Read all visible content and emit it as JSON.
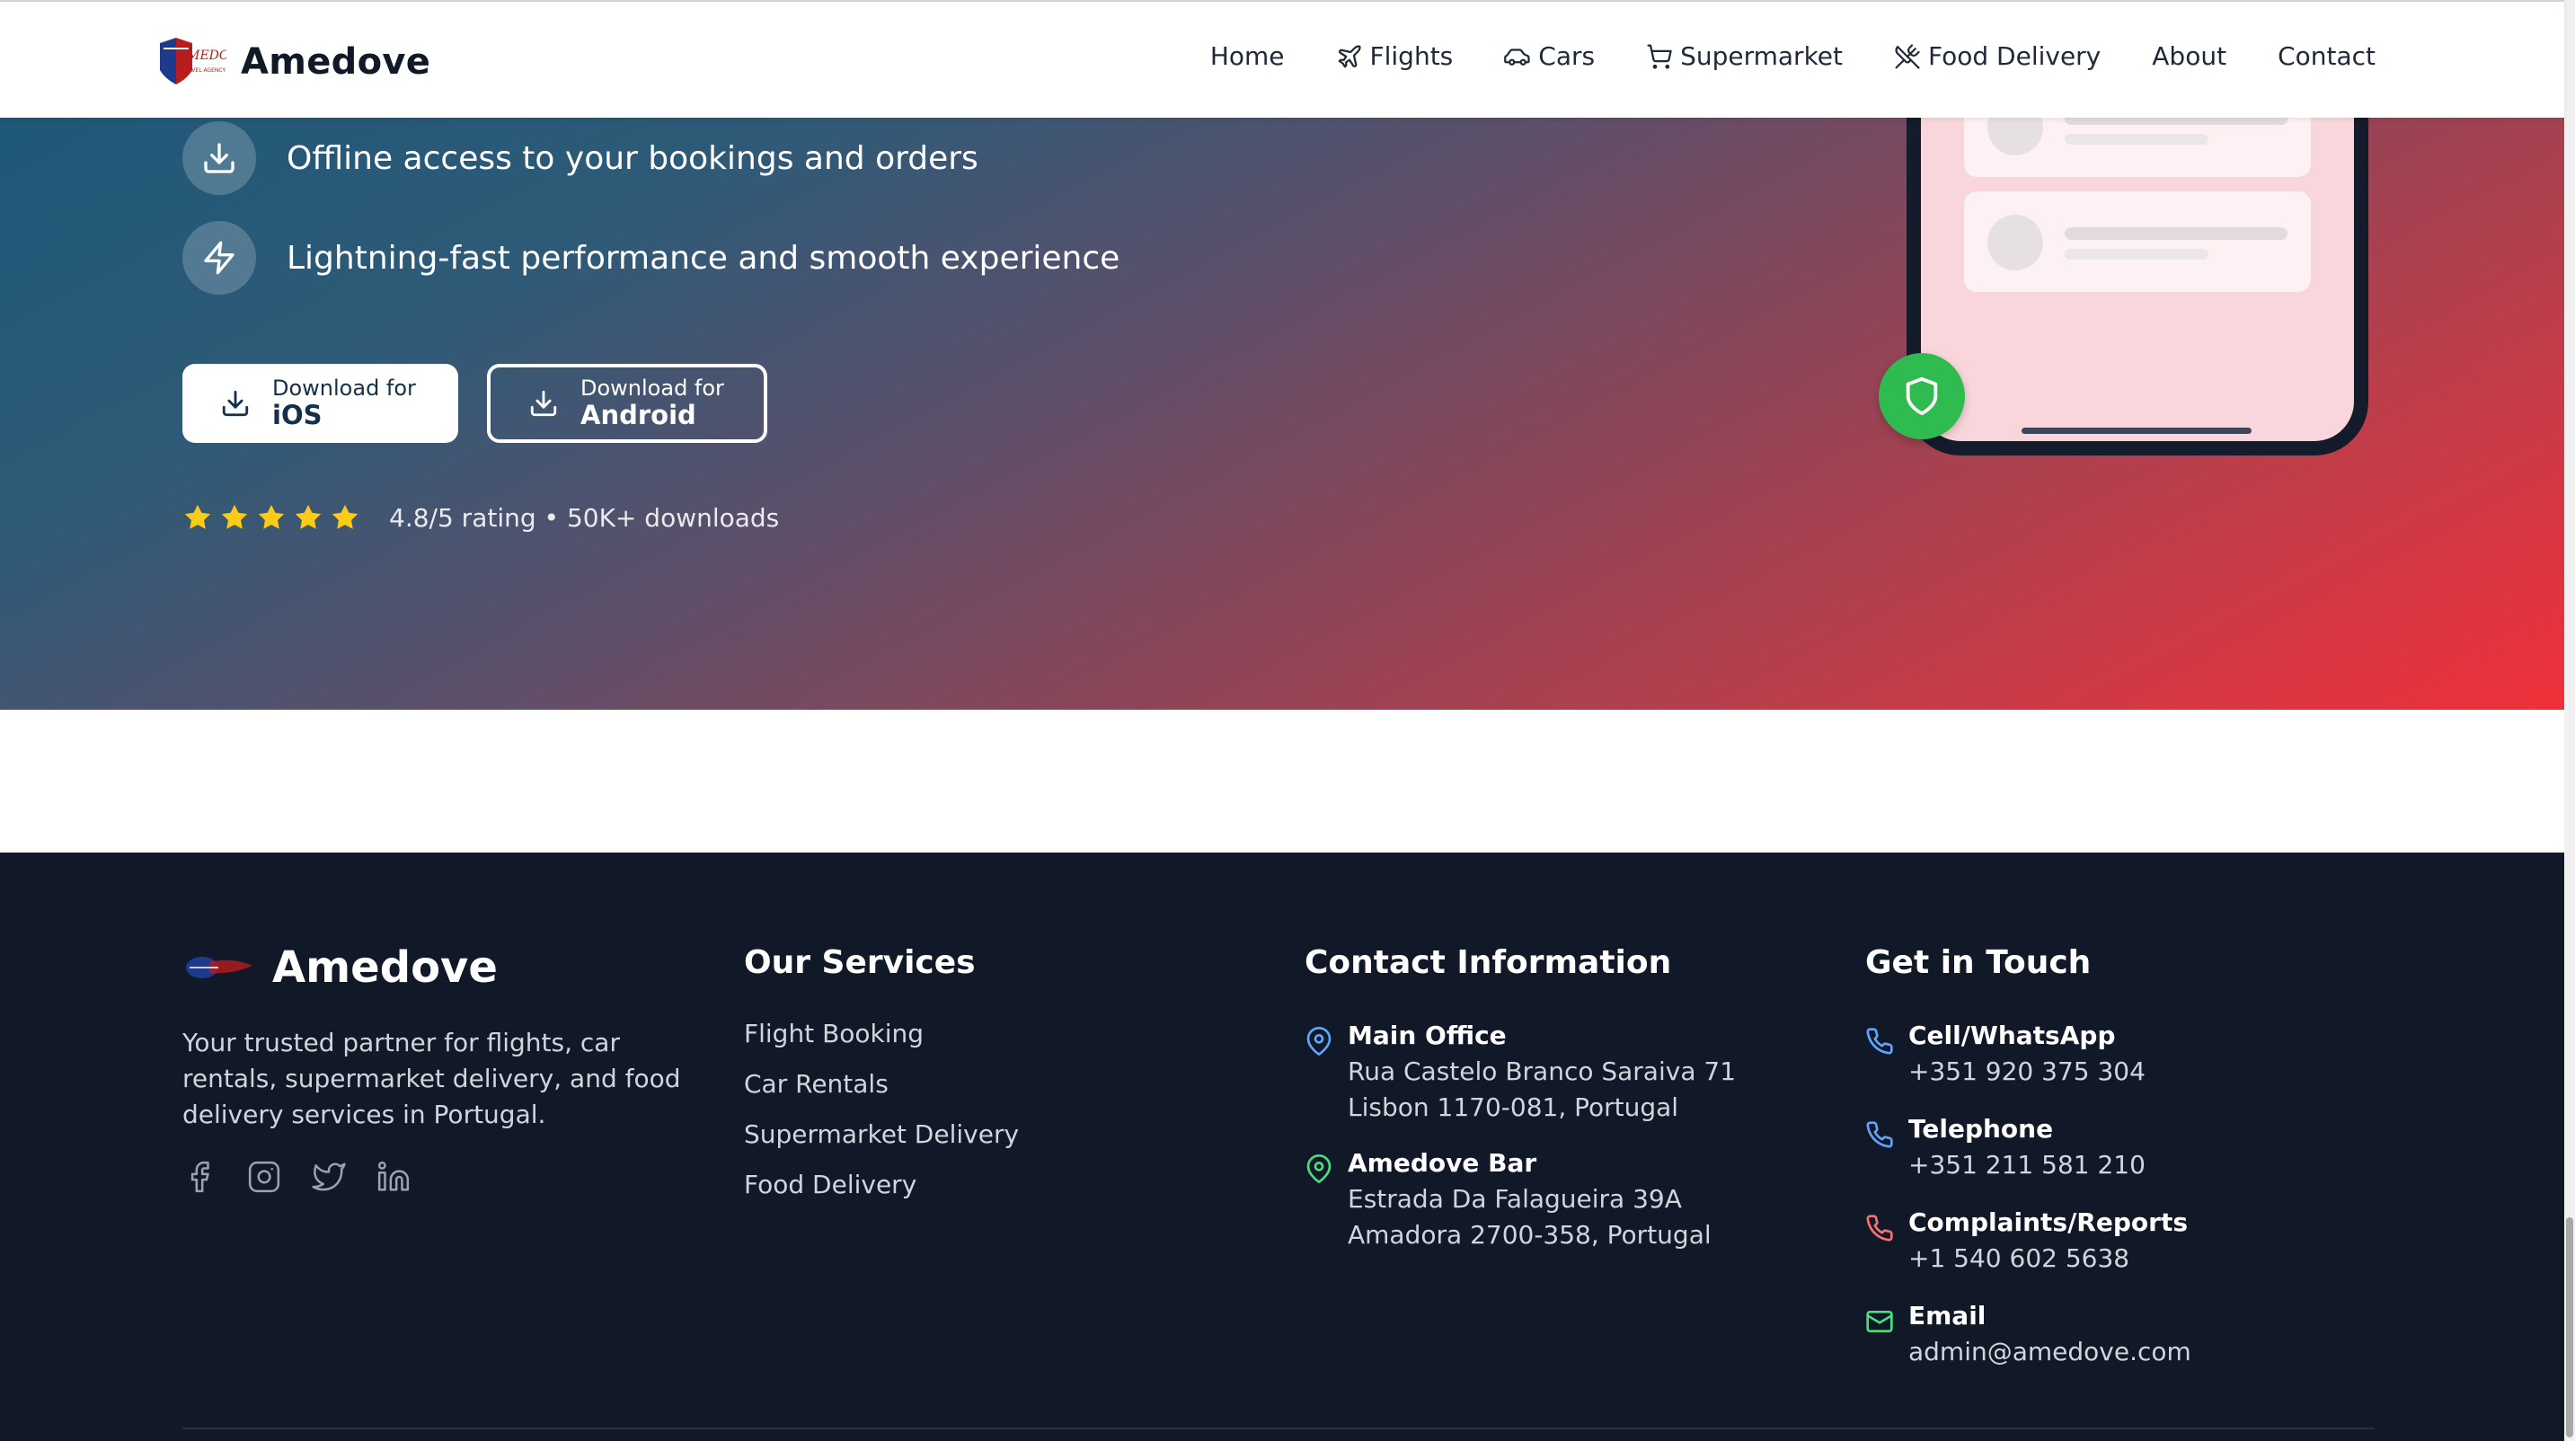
{
  "header": {
    "brand_name": "Amedove",
    "logo_text": "AMEDOVE",
    "logo_subtext": "TRAVEL AGENCY",
    "nav": [
      {
        "label": "Home",
        "icon": ""
      },
      {
        "label": "Flights",
        "icon": "plane-icon"
      },
      {
        "label": "Cars",
        "icon": "car-icon"
      },
      {
        "label": "Supermarket",
        "icon": "cart-icon"
      },
      {
        "label": "Food Delivery",
        "icon": "utensils-icon"
      },
      {
        "label": "About",
        "icon": ""
      },
      {
        "label": "Contact",
        "icon": ""
      }
    ]
  },
  "hero": {
    "features": [
      {
        "text": "Offline access to your bookings and orders",
        "icon": "download-icon"
      },
      {
        "text": "Lightning-fast performance and smooth experience",
        "icon": "lightning-icon"
      }
    ],
    "ios_button": {
      "small": "Download for",
      "big": "iOS"
    },
    "android_button": {
      "small": "Download for",
      "big": "Android"
    },
    "rating": {
      "stars": 5,
      "text": "4.8/5 rating • 50K+ downloads"
    },
    "colors": {
      "gradient_start": "#1f5878",
      "gradient_end": "#f0303a",
      "star": "#facc15",
      "shield_badge": "#2fbb4f"
    }
  },
  "footer": {
    "brand_name": "Amedove",
    "description": "Your trusted partner for flights, car rentals, supermarket delivery, and food delivery services in Portugal.",
    "socials": [
      "facebook-icon",
      "instagram-icon",
      "twitter-icon",
      "linkedin-icon"
    ],
    "services": {
      "title": "Our Services",
      "items": [
        "Flight Booking",
        "Car Rentals",
        "Supermarket Delivery",
        "Food Delivery"
      ]
    },
    "contact": {
      "title": "Contact Information",
      "items": [
        {
          "title": "Main Office",
          "lines": [
            "Rua Castelo Branco Saraiva 71",
            "Lisbon 1170-081, Portugal"
          ],
          "icon": "map-pin-icon",
          "color": "#60a5fa"
        },
        {
          "title": "Amedove Bar",
          "lines": [
            "Estrada Da Falagueira 39A",
            "Amadora 2700-358, Portugal"
          ],
          "icon": "map-pin-icon",
          "color": "#4ade80"
        }
      ]
    },
    "touch": {
      "title": "Get in Touch",
      "items": [
        {
          "title": "Cell/WhatsApp",
          "value": "+351 920 375 304",
          "icon": "phone-icon",
          "color": "#60a5fa"
        },
        {
          "title": "Telephone",
          "value": "+351 211 581 210",
          "icon": "phone-icon",
          "color": "#60a5fa"
        },
        {
          "title": "Complaints/Reports",
          "value": "+1 540 602 5638",
          "icon": "phone-icon",
          "color": "#f87171"
        },
        {
          "title": "Email",
          "value": "admin@amedove.com",
          "icon": "mail-icon",
          "color": "#4ade80"
        }
      ]
    },
    "colors": {
      "background": "#111827"
    }
  }
}
